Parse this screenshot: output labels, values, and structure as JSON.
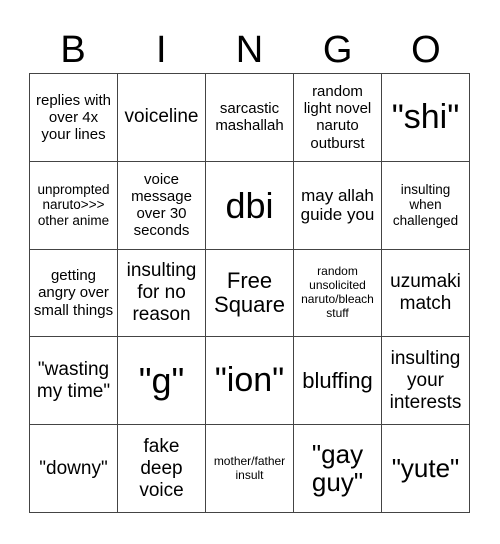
{
  "header": {
    "letters": [
      "B",
      "I",
      "N",
      "G",
      "O"
    ]
  },
  "cells": [
    "replies with over 4x your lines",
    "voiceline",
    "sarcastic mashallah",
    "random light novel naruto outburst",
    "\"shi\"",
    "unprompted naruto>>> other anime",
    "voice message over 30 seconds",
    "dbi",
    "may allah guide you",
    "insulting when challenged",
    "getting angry over small things",
    "insulting for no reason",
    "Free Square",
    "random unsolicited naruto/bleach stuff",
    "uzumaki match",
    "\"wasting my time\"",
    "\"g\"",
    "\"ion\"",
    "bluffing",
    "insulting your interests",
    "\"downy\"",
    "fake deep voice",
    "mother/father insult",
    "\"gay guy\"",
    "\"yute\""
  ]
}
